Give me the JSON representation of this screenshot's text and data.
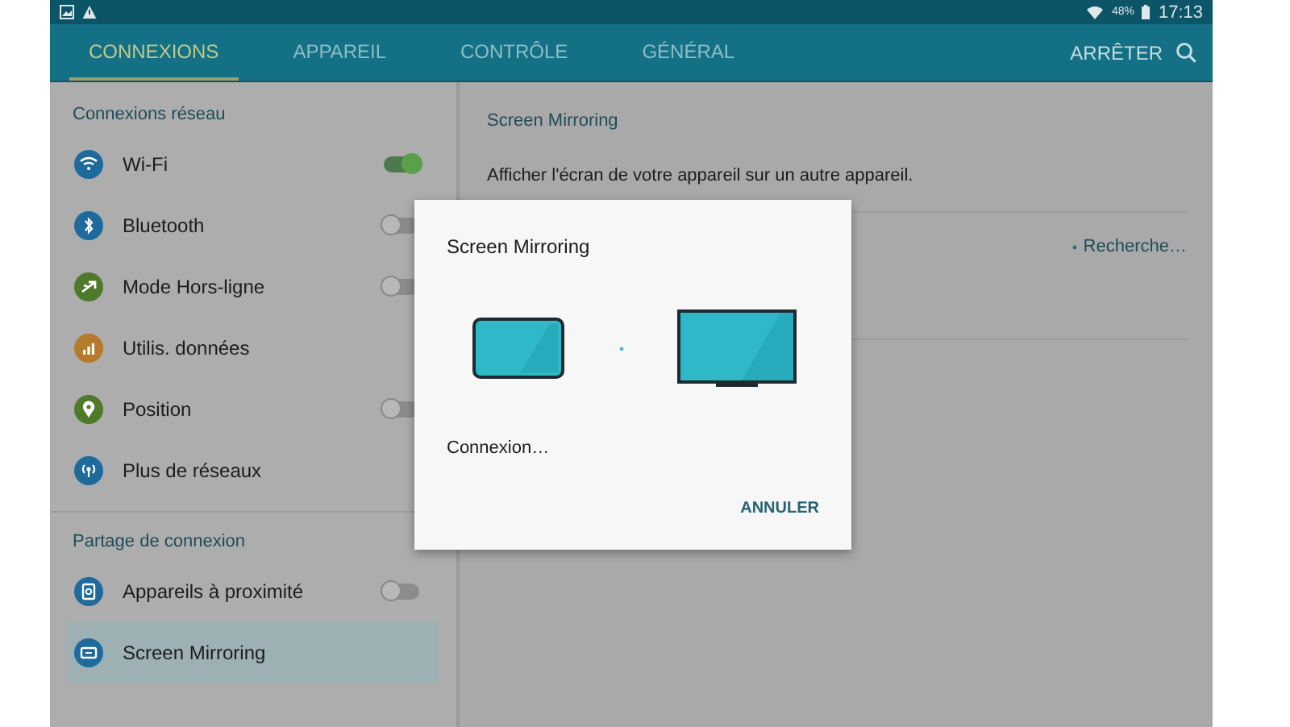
{
  "status_bar": {
    "battery": "48%",
    "time": "17:13"
  },
  "tabs": [
    {
      "label": "CONNEXIONS",
      "selected": true
    },
    {
      "label": "APPAREIL",
      "selected": false
    },
    {
      "label": "CONTRÔLE",
      "selected": false
    },
    {
      "label": "GÉNÉRAL",
      "selected": false
    }
  ],
  "action": "ARRÊTER",
  "sidebar": {
    "sections": [
      {
        "title": "Connexions réseau",
        "items": [
          {
            "label": "Wi-Fi",
            "color": "#1f6a9c",
            "kind": "toggle",
            "on": true,
            "selected": false
          },
          {
            "label": "Bluetooth",
            "color": "#1f6a9c",
            "kind": "toggle",
            "on": false,
            "selected": false
          },
          {
            "label": "Mode Hors-ligne",
            "color": "#4f7a2c",
            "kind": "toggle",
            "on": false,
            "selected": false
          },
          {
            "label": "Utilis. données",
            "color": "#b57a2a",
            "kind": "plain",
            "selected": false
          },
          {
            "label": "Position",
            "color": "#4f7a2c",
            "kind": "toggle",
            "on": false,
            "selected": false
          },
          {
            "label": "Plus de réseaux",
            "color": "#1f6a9c",
            "kind": "plain",
            "selected": false
          }
        ]
      },
      {
        "title": "Partage de connexion",
        "items": [
          {
            "label": "Appareils à proximité",
            "color": "#1f6a9c",
            "kind": "toggle",
            "on": false,
            "selected": false
          },
          {
            "label": "Screen Mirroring",
            "color": "#1f6a9c",
            "kind": "plain",
            "selected": true
          }
        ]
      }
    ]
  },
  "detail": {
    "title": "Screen Mirroring",
    "description": "Afficher l'écran de votre appareil sur un autre appareil.",
    "status": "Recherche…"
  },
  "dialog": {
    "title": "Screen Mirroring",
    "message": "Connexion…",
    "button": "ANNULER"
  }
}
